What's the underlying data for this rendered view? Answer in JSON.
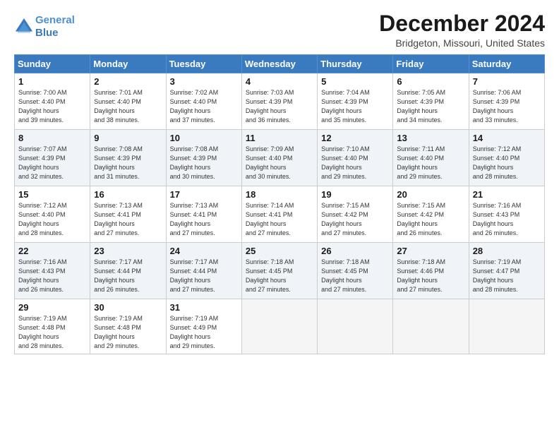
{
  "header": {
    "logo_line1": "General",
    "logo_line2": "Blue",
    "month_title": "December 2024",
    "location": "Bridgeton, Missouri, United States"
  },
  "days_of_week": [
    "Sunday",
    "Monday",
    "Tuesday",
    "Wednesday",
    "Thursday",
    "Friday",
    "Saturday"
  ],
  "weeks": [
    [
      {
        "day": "1",
        "sunrise": "7:00 AM",
        "sunset": "4:40 PM",
        "daylight": "9 hours and 39 minutes."
      },
      {
        "day": "2",
        "sunrise": "7:01 AM",
        "sunset": "4:40 PM",
        "daylight": "9 hours and 38 minutes."
      },
      {
        "day": "3",
        "sunrise": "7:02 AM",
        "sunset": "4:40 PM",
        "daylight": "9 hours and 37 minutes."
      },
      {
        "day": "4",
        "sunrise": "7:03 AM",
        "sunset": "4:39 PM",
        "daylight": "9 hours and 36 minutes."
      },
      {
        "day": "5",
        "sunrise": "7:04 AM",
        "sunset": "4:39 PM",
        "daylight": "9 hours and 35 minutes."
      },
      {
        "day": "6",
        "sunrise": "7:05 AM",
        "sunset": "4:39 PM",
        "daylight": "9 hours and 34 minutes."
      },
      {
        "day": "7",
        "sunrise": "7:06 AM",
        "sunset": "4:39 PM",
        "daylight": "9 hours and 33 minutes."
      }
    ],
    [
      {
        "day": "8",
        "sunrise": "7:07 AM",
        "sunset": "4:39 PM",
        "daylight": "9 hours and 32 minutes."
      },
      {
        "day": "9",
        "sunrise": "7:08 AM",
        "sunset": "4:39 PM",
        "daylight": "9 hours and 31 minutes."
      },
      {
        "day": "10",
        "sunrise": "7:08 AM",
        "sunset": "4:39 PM",
        "daylight": "9 hours and 30 minutes."
      },
      {
        "day": "11",
        "sunrise": "7:09 AM",
        "sunset": "4:40 PM",
        "daylight": "9 hours and 30 minutes."
      },
      {
        "day": "12",
        "sunrise": "7:10 AM",
        "sunset": "4:40 PM",
        "daylight": "9 hours and 29 minutes."
      },
      {
        "day": "13",
        "sunrise": "7:11 AM",
        "sunset": "4:40 PM",
        "daylight": "9 hours and 29 minutes."
      },
      {
        "day": "14",
        "sunrise": "7:12 AM",
        "sunset": "4:40 PM",
        "daylight": "9 hours and 28 minutes."
      }
    ],
    [
      {
        "day": "15",
        "sunrise": "7:12 AM",
        "sunset": "4:40 PM",
        "daylight": "9 hours and 28 minutes."
      },
      {
        "day": "16",
        "sunrise": "7:13 AM",
        "sunset": "4:41 PM",
        "daylight": "9 hours and 27 minutes."
      },
      {
        "day": "17",
        "sunrise": "7:13 AM",
        "sunset": "4:41 PM",
        "daylight": "9 hours and 27 minutes."
      },
      {
        "day": "18",
        "sunrise": "7:14 AM",
        "sunset": "4:41 PM",
        "daylight": "9 hours and 27 minutes."
      },
      {
        "day": "19",
        "sunrise": "7:15 AM",
        "sunset": "4:42 PM",
        "daylight": "9 hours and 27 minutes."
      },
      {
        "day": "20",
        "sunrise": "7:15 AM",
        "sunset": "4:42 PM",
        "daylight": "9 hours and 26 minutes."
      },
      {
        "day": "21",
        "sunrise": "7:16 AM",
        "sunset": "4:43 PM",
        "daylight": "9 hours and 26 minutes."
      }
    ],
    [
      {
        "day": "22",
        "sunrise": "7:16 AM",
        "sunset": "4:43 PM",
        "daylight": "9 hours and 26 minutes."
      },
      {
        "day": "23",
        "sunrise": "7:17 AM",
        "sunset": "4:44 PM",
        "daylight": "9 hours and 26 minutes."
      },
      {
        "day": "24",
        "sunrise": "7:17 AM",
        "sunset": "4:44 PM",
        "daylight": "9 hours and 27 minutes."
      },
      {
        "day": "25",
        "sunrise": "7:18 AM",
        "sunset": "4:45 PM",
        "daylight": "9 hours and 27 minutes."
      },
      {
        "day": "26",
        "sunrise": "7:18 AM",
        "sunset": "4:45 PM",
        "daylight": "9 hours and 27 minutes."
      },
      {
        "day": "27",
        "sunrise": "7:18 AM",
        "sunset": "4:46 PM",
        "daylight": "9 hours and 27 minutes."
      },
      {
        "day": "28",
        "sunrise": "7:19 AM",
        "sunset": "4:47 PM",
        "daylight": "9 hours and 28 minutes."
      }
    ],
    [
      {
        "day": "29",
        "sunrise": "7:19 AM",
        "sunset": "4:48 PM",
        "daylight": "9 hours and 28 minutes."
      },
      {
        "day": "30",
        "sunrise": "7:19 AM",
        "sunset": "4:48 PM",
        "daylight": "9 hours and 29 minutes."
      },
      {
        "day": "31",
        "sunrise": "7:19 AM",
        "sunset": "4:49 PM",
        "daylight": "9 hours and 29 minutes."
      },
      null,
      null,
      null,
      null
    ]
  ]
}
